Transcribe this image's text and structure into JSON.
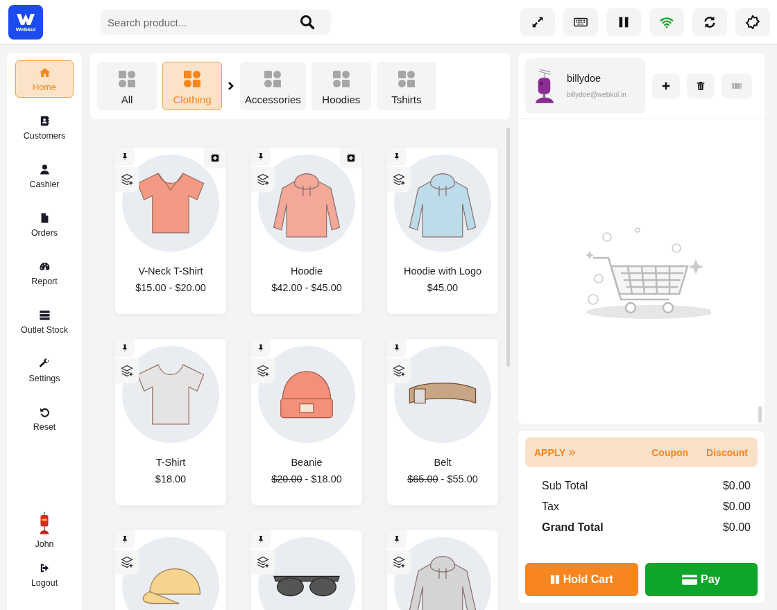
{
  "logo": {
    "text": "Webkul"
  },
  "search": {
    "placeholder": "Search product..."
  },
  "header_buttons": [
    {
      "kind": "expand"
    },
    {
      "kind": "keyboard"
    },
    {
      "kind": "pause"
    },
    {
      "kind": "wifi",
      "connected": true
    },
    {
      "kind": "sync"
    },
    {
      "kind": "settings"
    }
  ],
  "sidebar": {
    "items": [
      {
        "kind": "home",
        "label": "Home",
        "selected": true
      },
      {
        "kind": "customers",
        "label": "Customers",
        "selected": false
      },
      {
        "kind": "cashier",
        "label": "Cashier",
        "selected": false
      },
      {
        "kind": "orders",
        "label": "Orders",
        "selected": false
      },
      {
        "kind": "report",
        "label": "Report",
        "selected": false
      },
      {
        "kind": "stock",
        "label": "Outlet Stock",
        "selected": false
      },
      {
        "kind": "settings",
        "label": "Settings",
        "selected": false
      },
      {
        "kind": "reset",
        "label": "Reset",
        "selected": false
      }
    ],
    "user": {
      "name": "John"
    },
    "logout": {
      "label": "Logout"
    }
  },
  "categories": [
    {
      "label": "All",
      "selected": false
    },
    {
      "label": "Clothing",
      "selected": true
    },
    {
      "label": "Accessories",
      "selected": false
    },
    {
      "label": "Hoodies",
      "selected": false
    },
    {
      "label": "Tshirts",
      "selected": false
    }
  ],
  "products": [
    {
      "kind": "vneck",
      "color": "#f49a84",
      "name": "V-Neck T-Shirt",
      "price": "$15.00 - $20.00",
      "variants": true
    },
    {
      "kind": "hoodie",
      "color": "#f4a898",
      "name": "Hoodie",
      "price": "$42.00 - $45.00",
      "variants": true
    },
    {
      "kind": "hoodie",
      "color": "#bcdcea",
      "name": "Hoodie with Logo",
      "price": "$45.00",
      "variants": false
    },
    {
      "kind": "tshirt",
      "color": "#e4e4e4",
      "name": "T-Shirt",
      "price": "$18.00",
      "variants": false
    },
    {
      "kind": "beanie",
      "color": "#f4907a",
      "name": "Beanie",
      "old_price": "$20.00",
      "separator": "-",
      "price": "$18.00",
      "variants": false
    },
    {
      "kind": "belt",
      "color": "#c8a585",
      "name": "Belt",
      "old_price": "$65.00",
      "separator": "-",
      "price": "$55.00",
      "variants": false
    },
    {
      "kind": "cap",
      "color": "#f6d38e",
      "variants": false
    },
    {
      "kind": "sunglasses",
      "color": "#555555",
      "variants": false
    },
    {
      "kind": "hoodie",
      "color": "#d4d4d4",
      "variants": false
    }
  ],
  "customer": {
    "name": "billydoe",
    "email": "billydoe@webkul.in"
  },
  "customer_actions": [
    {
      "kind": "add"
    },
    {
      "kind": "delete"
    },
    {
      "kind": "barcode"
    }
  ],
  "apply_bar": {
    "label": "APPLY",
    "links": [
      "Coupon",
      "Discount"
    ]
  },
  "totals": [
    {
      "label": "Sub Total",
      "value": "$0.00",
      "emphasis": false
    },
    {
      "label": "Tax",
      "value": "$0.00",
      "emphasis": false
    },
    {
      "label": "Grand Total",
      "value": "$0.00",
      "emphasis": true
    }
  ],
  "actions": [
    {
      "kind": "hold",
      "label": "Hold Cart"
    },
    {
      "kind": "pay",
      "label": "Pay"
    }
  ]
}
